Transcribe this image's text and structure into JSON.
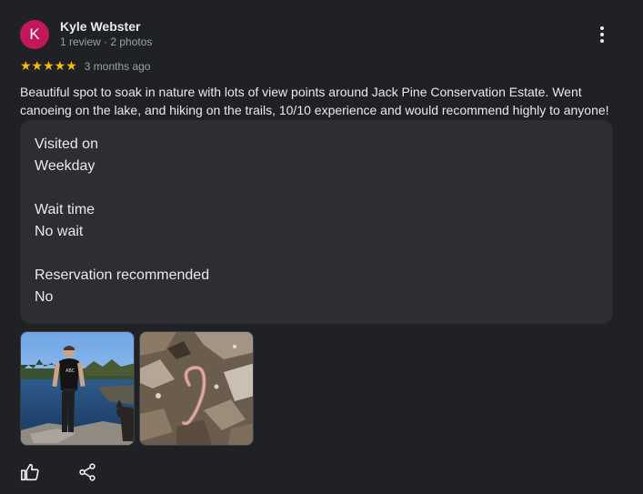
{
  "reviewer": {
    "initial": "K",
    "name": "Kyle Webster",
    "meta": "1 review · 2 photos",
    "avatar_color": "#c2185b"
  },
  "rating": {
    "stars": "★★★★★",
    "value": 5,
    "max": 5,
    "date": "3 months ago",
    "star_color": "#fbbc04"
  },
  "review_text": "Beautiful spot to soak in nature with lots of view points around Jack Pine Conservation Estate. Went canoeing on the lake, and hiking on the trails, 10/10 experience and would recommend highly to anyone!",
  "details": [
    {
      "label": "Visited on",
      "value": "Weekday"
    },
    {
      "label": "Wait time",
      "value": "No wait"
    },
    {
      "label": "Reservation recommended",
      "value": "No"
    }
  ],
  "icons": {
    "more": "more-vert-icon",
    "like": "thumb-up-icon",
    "share": "share-icon"
  }
}
